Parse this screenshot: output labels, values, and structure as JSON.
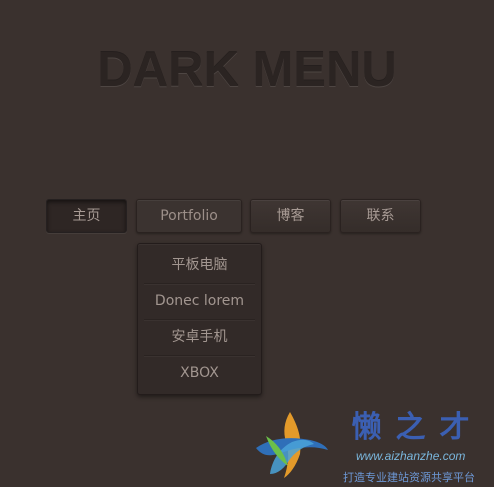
{
  "header": {
    "title": "DARK MENU"
  },
  "menu": {
    "items": [
      {
        "label": "主页"
      },
      {
        "label": "Portfolio"
      },
      {
        "label": "博客"
      },
      {
        "label": "联系"
      }
    ],
    "submenu": [
      {
        "label": "平板电脑"
      },
      {
        "label": "Donec lorem"
      },
      {
        "label": "安卓手机"
      },
      {
        "label": "XBOX"
      }
    ]
  },
  "watermark": {
    "brand": "懒之才",
    "url": "www.aizhanzhe.com",
    "slogan": "打造专业建站资源共享平台"
  },
  "colors": {
    "background": "#3a312e",
    "text": "#a79a94",
    "brand_blue": "#3b5fb2"
  }
}
